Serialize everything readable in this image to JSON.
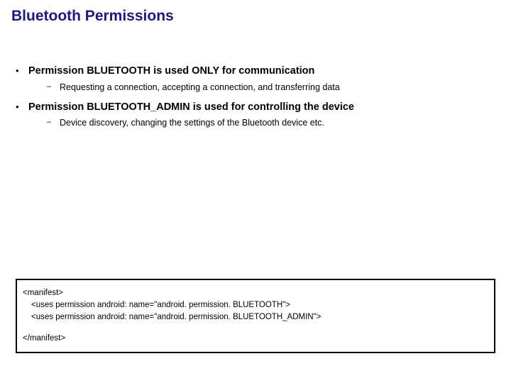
{
  "title": "Bluetooth Permissions",
  "bullets": [
    {
      "text": "Permission BLUETOOTH is used ONLY for communication",
      "sub": "Requesting a connection, accepting a connection, and transferring data"
    },
    {
      "text": "Permission BLUETOOTH_ADMIN is used for controlling the device",
      "sub": "Device discovery, changing the settings of the Bluetooth device etc."
    }
  ],
  "code": {
    "l1": "<manifest>",
    "l2": "<uses permission android: name=\"android. permission. BLUETOOTH\">",
    "l3": "<uses permission android: name=\"android. permission. BLUETOOTH_ADMIN\">",
    "l4": "</manifest>"
  }
}
